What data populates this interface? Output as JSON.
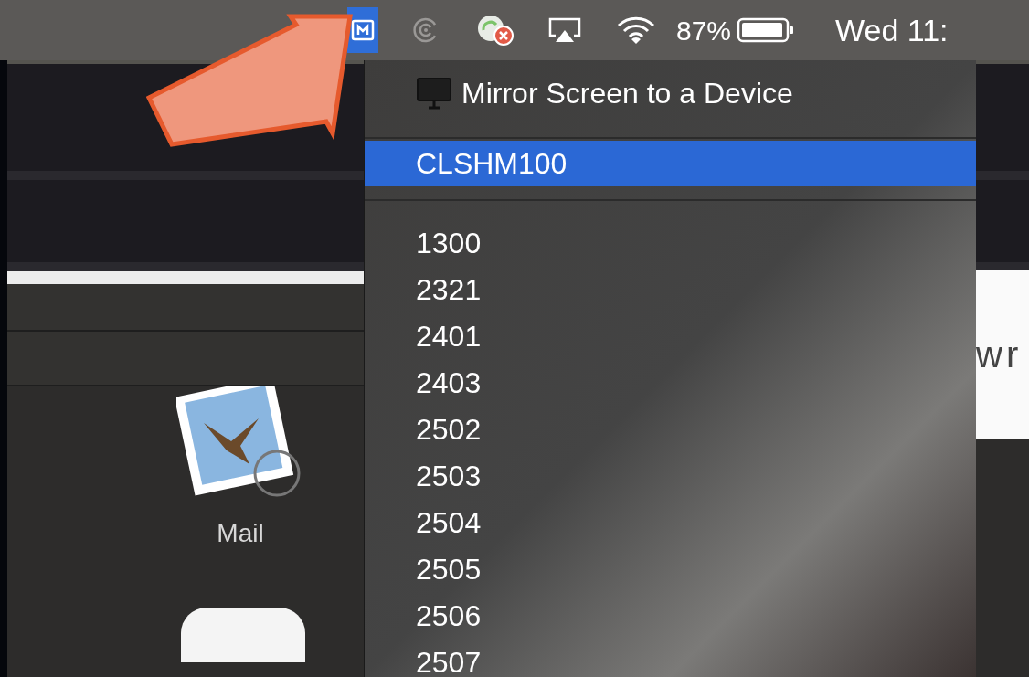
{
  "menu_bar": {
    "app_icon_selected": true,
    "battery": "87%",
    "clock": "Wed 11:"
  },
  "menu": {
    "header": "Mirror Screen to a Device",
    "devices": [
      {
        "label": "CLSHM100",
        "selected": true
      }
    ],
    "items": [
      {
        "label": "1300",
        "selected": false
      },
      {
        "label": "2321",
        "selected": false
      },
      {
        "label": "2401",
        "selected": false
      },
      {
        "label": "2403",
        "selected": false
      },
      {
        "label": "2502",
        "selected": false
      },
      {
        "label": "2503",
        "selected": false
      },
      {
        "label": "2504",
        "selected": false
      },
      {
        "label": "2505",
        "selected": false
      },
      {
        "label": "2506",
        "selected": false
      },
      {
        "label": "2507",
        "selected": false
      }
    ]
  },
  "apps": [
    {
      "label": "Mail"
    }
  ],
  "background_text": "wr"
}
